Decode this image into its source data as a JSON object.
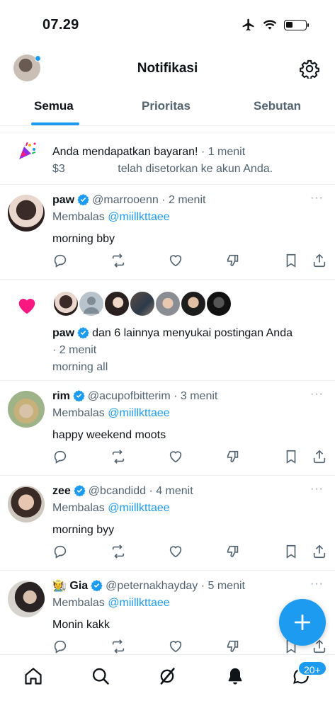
{
  "status_bar": {
    "time": "07.29"
  },
  "header": {
    "title": "Notifikasi"
  },
  "tabs": [
    {
      "label": "Semua",
      "active": true
    },
    {
      "label": "Prioritas",
      "active": false
    },
    {
      "label": "Sebutan",
      "active": false
    }
  ],
  "payout": {
    "title": "Anda mendapatkan bayaran!",
    "time": "· 1 menit",
    "amount_prefix": "$3",
    "message": "telah disetorkan ke akun Anda."
  },
  "replies": [
    {
      "name": "paw",
      "handle": "@marrooenn",
      "time": "· 2 menit",
      "replying_label": "Membalas",
      "replying_to": "@miillkttaee",
      "text": "morning bby",
      "more": "···"
    },
    {
      "name": "rim",
      "handle": "@acupofbitterim",
      "time": "· 3 menit",
      "replying_label": "Membalas",
      "replying_to": "@miillkttaee",
      "text": "happy weekend moots",
      "more": "···"
    },
    {
      "name": "zee",
      "handle": "@bcandidd",
      "time": "· 4 menit",
      "replying_label": "Membalas",
      "replying_to": "@miillkttaee",
      "text": "morning byy",
      "more": "···"
    },
    {
      "name": "🧑‍🌾 Gia",
      "handle": "@peternakhayday",
      "time": "· 5 menit",
      "replying_label": "Membalas",
      "replying_to": "@miillkttaee",
      "text": "Monin kakk",
      "more": "···"
    }
  ],
  "like_notification": {
    "name": "paw",
    "summary": "dan 6 lainnya menyukai postingan Anda",
    "time": "· 2 menit",
    "post_text": "morning all"
  },
  "nav": {
    "messages_badge": "20+"
  },
  "colors": {
    "accent": "#1d9bf0",
    "like": "#f91880",
    "text": "#0f1419",
    "muted": "#536471"
  }
}
